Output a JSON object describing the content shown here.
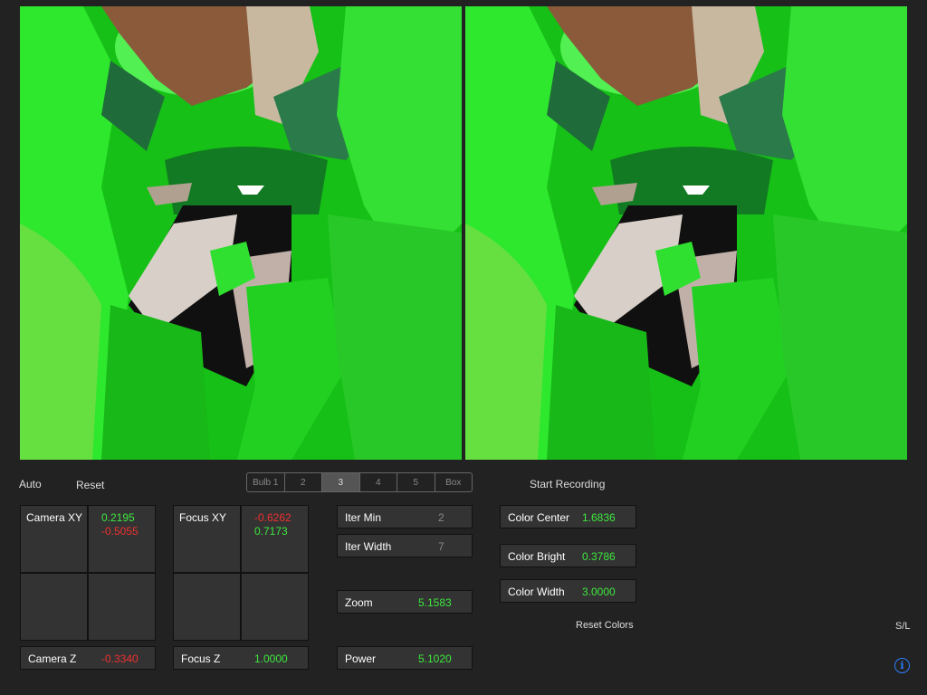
{
  "controls": {
    "auto_label": "Auto",
    "reset_label": "Reset",
    "start_recording_label": "Start Recording",
    "reset_colors_label": "Reset Colors",
    "sl_label": "S/L"
  },
  "formula_tabs": [
    {
      "label": "Bulb 1",
      "active": false
    },
    {
      "label": "2",
      "active": false
    },
    {
      "label": "3",
      "active": true
    },
    {
      "label": "4",
      "active": false
    },
    {
      "label": "5",
      "active": false
    },
    {
      "label": "Box",
      "active": false
    }
  ],
  "camera_xy": {
    "label": "Camera XY",
    "x": "0.2195",
    "y": "-0.5055"
  },
  "focus_xy": {
    "label": "Focus XY",
    "x": "-0.6262",
    "y": "0.7173"
  },
  "camera_z": {
    "label": "Camera Z",
    "value": "-0.3340"
  },
  "focus_z": {
    "label": "Focus Z",
    "value": "1.0000"
  },
  "iter_min": {
    "label": "Iter Min",
    "value": "2"
  },
  "iter_width": {
    "label": "Iter Width",
    "value": "7"
  },
  "zoom": {
    "label": "Zoom",
    "value": "5.1583"
  },
  "power": {
    "label": "Power",
    "value": "5.1020"
  },
  "color_center": {
    "label": "Color Center",
    "value": "1.6836"
  },
  "color_bright": {
    "label": "Color Bright",
    "value": "0.3786"
  },
  "color_width": {
    "label": "Color Width",
    "value": "3.0000"
  },
  "colors": {
    "background": "#222222",
    "positive_value": "#3ee83e",
    "negative_value": "#f03030",
    "info_accent": "#2a7fff"
  },
  "icons": {
    "info": "info-icon"
  }
}
